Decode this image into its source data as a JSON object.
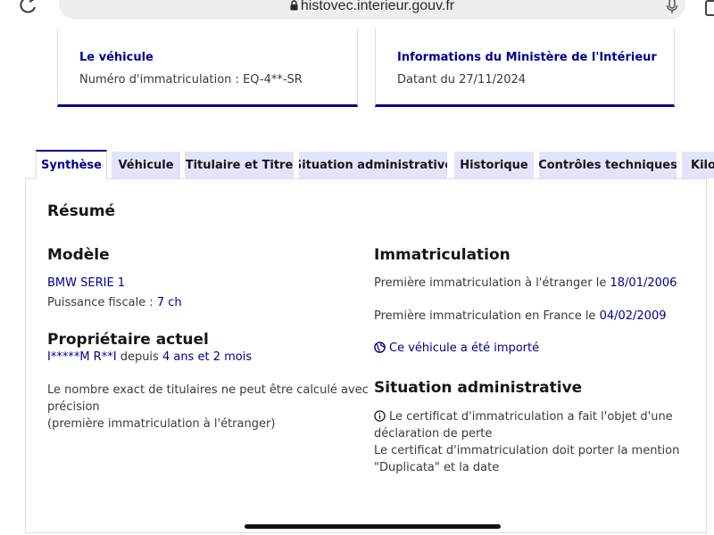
{
  "browser": {
    "url": "histovec.interieur.gouv.fr"
  },
  "cards": {
    "vehicle": {
      "title": "Le véhicule",
      "text": "Numéro d'immatriculation : EQ-4**-SR"
    },
    "ministry": {
      "title": "Informations du Ministère de l'Intérieur",
      "text": "Datant du 27/11/2024"
    }
  },
  "tabs": [
    {
      "label": "Synthèse",
      "active": true
    },
    {
      "label": "Véhicule",
      "active": false
    },
    {
      "label": "Titulaire et Titre",
      "active": false
    },
    {
      "label": "Situation administrative",
      "active": false
    },
    {
      "label": "Historique",
      "active": false
    },
    {
      "label": "Contrôles techniques",
      "active": false
    },
    {
      "label": "Kilo",
      "active": false
    }
  ],
  "summary": {
    "title": "Résumé",
    "model": {
      "heading": "Modèle",
      "name": "BMW SERIE 1",
      "fiscal_label": "Puissance fiscale : ",
      "fiscal_value": "7 ch"
    },
    "owner": {
      "heading": "Propriétaire actuel",
      "name": "I*****M R**I",
      "since_label": " depuis ",
      "since_value": "4 ans et 2 mois",
      "note_line1": "Le nombre exact de titulaires ne peut être calculé avec",
      "note_line2": "précision",
      "note_line3": "(première immatriculation à l'étranger)"
    },
    "registration": {
      "heading": "Immatriculation",
      "foreign_label": "Première immatriculation à l'étranger le ",
      "foreign_date": "18/01/2006",
      "france_label": "Première immatriculation en France le ",
      "france_date": "04/02/2009",
      "imported_link": "Ce véhicule a été importé"
    },
    "admin": {
      "heading": "Situation administrative",
      "line1": "Le certificat d'immatriculation a fait l'objet d'une",
      "line2": "déclaration de perte",
      "line3": "Le certificat d'immatriculation doit porter la mention",
      "line4": "\"Duplicata\" et la date"
    }
  },
  "colors": {
    "accent": "#000091",
    "tab_bg": "#e3e3fd",
    "text": "#3a3a3a"
  }
}
